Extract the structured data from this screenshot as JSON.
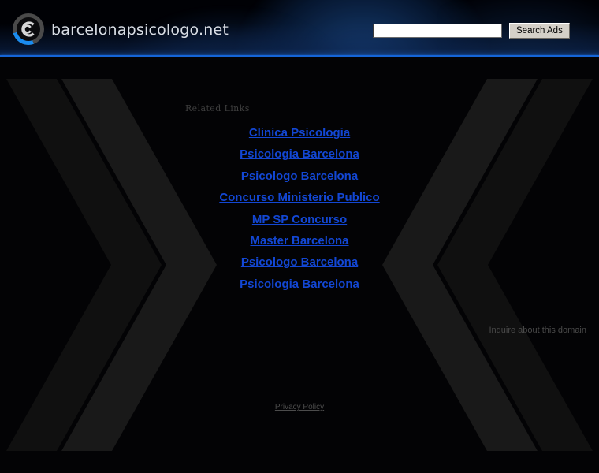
{
  "header": {
    "site_title": "barcelonapsicologo.net",
    "logo_icon": "circular-c-logo-icon",
    "accent_color": "#1565d8",
    "logo_arc_color": "#1a8cf0",
    "search": {
      "value": "",
      "placeholder": "",
      "button_label": "Search Ads"
    }
  },
  "main": {
    "related_heading": "Related Links",
    "links": [
      {
        "label": "Clinica Psicologia"
      },
      {
        "label": "Psicologia Barcelona"
      },
      {
        "label": "Psicologo Barcelona"
      },
      {
        "label": "Concurso Ministerio Publico"
      },
      {
        "label": "MP SP Concurso"
      },
      {
        "label": "Master Barcelona"
      },
      {
        "label": "Psicologo Barcelona"
      },
      {
        "label": "Psicologia Barcelona"
      }
    ],
    "link_color": "#1347d4",
    "inquire_label": "Inquire about this domain"
  },
  "footer": {
    "privacy_label": "Privacy Policy"
  },
  "background": {
    "page_color": "#030305",
    "chevron_color": "#121212",
    "decoration": "double-chevron-pattern"
  }
}
